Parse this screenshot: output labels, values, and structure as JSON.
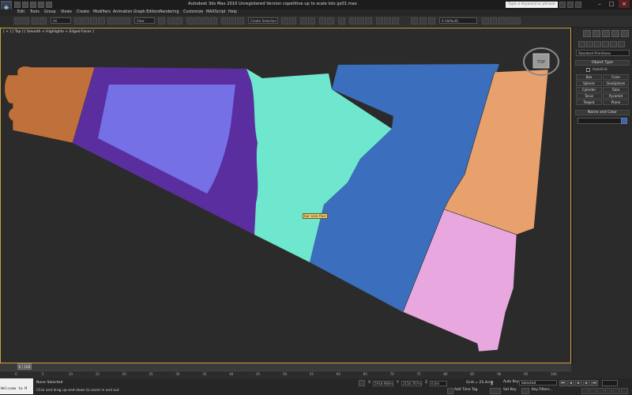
{
  "app": {
    "title": "Autodesk 3ds Max  2010      Unregistered Version     copetitive up to scale lots gs01.max",
    "search_placeholder": "Type a keyword or phrase"
  },
  "menu": [
    "Edit",
    "Tools",
    "Group",
    "Views",
    "Create",
    "Modifiers",
    "Animation",
    "Graph Editors",
    "Rendering",
    "Customize",
    "MAXScript",
    "Help"
  ],
  "toolbar": {
    "filter_dropdown": "All",
    "view_dropdown": "View",
    "selection_set": "Create Selection",
    "layer_dropdown": "0 (default)"
  },
  "viewport": {
    "label": "[ + ] [ Top ] [ Smooth + Highlights + Edged Faces ]",
    "viewcube_label": "TOP",
    "viewcube_compass": "S",
    "tooltip": "bar area floor",
    "colors": {
      "orange_bay": "#c0703a",
      "purple_frame": "#5b2ea0",
      "lavender": "#7570e6",
      "mint": "#6fe7cf",
      "blue": "#3b6fbd",
      "peach": "#e8a06c",
      "pink": "#e8a8df",
      "background": "#2b2b2b"
    }
  },
  "command_panel": {
    "primitive_dropdown": "Standard Primitives",
    "object_type_title": "Object Type",
    "autogrid": "AutoGrid",
    "buttons": [
      "Box",
      "Cone",
      "Sphere",
      "GeoSphere",
      "Cylinder",
      "Tube",
      "Torus",
      "Pyramid",
      "Teapot",
      "Plane"
    ],
    "name_color_title": "Name and Color",
    "color": "#2a66c8"
  },
  "timeline": {
    "slider": "0 / 100",
    "ticks": [
      "0",
      "5",
      "10",
      "15",
      "20",
      "25",
      "30",
      "35",
      "40",
      "45",
      "50",
      "55",
      "60",
      "65",
      "70",
      "75",
      "80",
      "85",
      "90",
      "95",
      "100"
    ]
  },
  "status": {
    "maxscript": "Welcome to M",
    "selection": "None Selected",
    "hint": "Click and drag up-and-down to zoom in and out",
    "x_label": "X",
    "x_value": "5918.906m",
    "y_label": "Y",
    "y_value": "2156.767m",
    "z_label": "Z",
    "z_value": "0.0m",
    "grid": "Grid = 25.4cm",
    "add_time_tag": "Add Time Tag",
    "auto_key": "Auto Key",
    "selected_dropdown": "Selected",
    "set_key": "Set Key",
    "key_filters": "Key Filters..."
  }
}
